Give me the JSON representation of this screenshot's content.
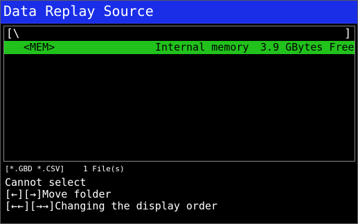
{
  "window": {
    "title": "Data Replay Source"
  },
  "path": {
    "open_bracket": "[\\",
    "close_bracket": "]"
  },
  "files": [
    {
      "name": "<MEM>",
      "description": "Internal memory",
      "size": "3.9 GBytes Free"
    }
  ],
  "status": {
    "filter": "[*.GBD *.CSV]",
    "count": "1 File(s)"
  },
  "help_lines": [
    "Cannot select",
    "[←][→]Move folder",
    "[←←][→→]Changing the display order"
  ],
  "colors": {
    "title_bar": "#1a2ee8",
    "selection": "#22c21c",
    "background": "#000000",
    "text": "#ffffff"
  }
}
